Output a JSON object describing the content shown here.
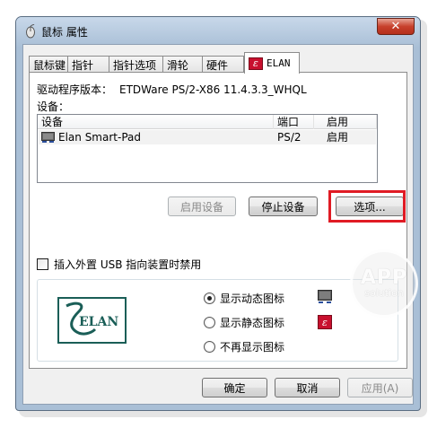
{
  "window": {
    "title": "鼠标 属性",
    "close_symbol": "✕"
  },
  "tabs": [
    {
      "label": "鼠标键"
    },
    {
      "label": "指针"
    },
    {
      "label": "指针选项"
    },
    {
      "label": "滑轮"
    },
    {
      "label": "硬件"
    },
    {
      "label": "ELAN",
      "active": true
    }
  ],
  "elan": {
    "driver_label": "驱动程序版本：",
    "driver_version": "ETDWare PS/2-X86 11.4.3.3_WHQL",
    "devices_label": "设备：",
    "columns": [
      "设备",
      "端口",
      "启用"
    ],
    "devices": [
      {
        "name": "Elan Smart-Pad",
        "port": "PS/2",
        "enabled": "启用"
      }
    ],
    "buttons": {
      "enable": "启用设备",
      "stop": "停止设备",
      "options": "选项..."
    },
    "disable_checkbox": "插入外置 USB 指向装置时禁用",
    "tray_options": [
      {
        "label": "显示动态图标",
        "checked": true,
        "icon": "monitor-icon"
      },
      {
        "label": "显示静态图标",
        "checked": false,
        "icon": "elan-icon"
      },
      {
        "label": "不再显示图标",
        "checked": false,
        "icon": ""
      }
    ],
    "logo_text": "ELAN"
  },
  "footer": {
    "ok": "确定",
    "cancel": "取消",
    "apply": "应用(A)"
  },
  "watermark": {
    "big": "APP",
    "small": "solution"
  },
  "colors": {
    "highlight": "#e01b24",
    "elan_red": "#c8102e",
    "logo_green": "#1a5e57"
  }
}
